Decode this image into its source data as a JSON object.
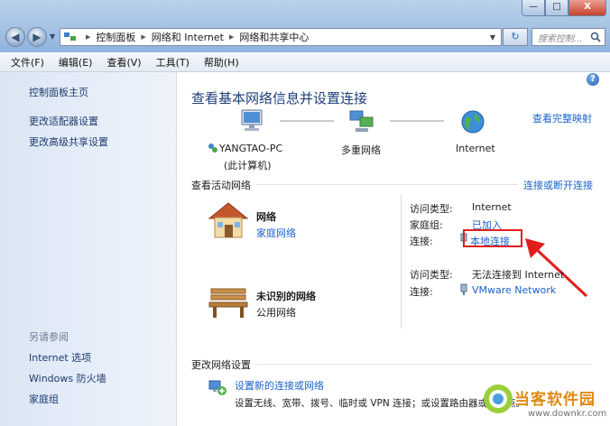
{
  "window": {
    "min": "—",
    "max": "□",
    "close": "X"
  },
  "address": {
    "crumbs": [
      "控制面板",
      "网络和 Internet",
      "网络和共享中心"
    ]
  },
  "search": {
    "placeholder": "搜索控制..."
  },
  "menu": [
    "文件(F)",
    "编辑(E)",
    "查看(V)",
    "工具(T)",
    "帮助(H)"
  ],
  "sidebar": {
    "home": "控制面板主页",
    "adapter": "更改适配器设置",
    "advanced": "更改高级共享设置",
    "see_also": "另请参阅",
    "links": [
      "Internet 选项",
      "Windows 防火墙",
      "家庭组"
    ]
  },
  "main": {
    "title": "查看基本网络信息并设置连接",
    "full_map": "查看完整映射",
    "map": {
      "pc_name": "YANGTAO-PC",
      "pc_sub": "(此计算机)",
      "middle": "多重网络",
      "internet": "Internet"
    },
    "active_header": "查看活动网络",
    "connect_disconnect": "连接或断开连接",
    "network1": {
      "name": "网络",
      "type": "家庭网络",
      "access_label": "访问类型:",
      "access_value": "Internet",
      "homegroup_label": "家庭组:",
      "homegroup_value": "已加入",
      "conn_label": "连接:",
      "conn_value": "本地连接"
    },
    "network2": {
      "name": "未识别的网络",
      "type": "公用网络",
      "access_label": "访问类型:",
      "access_value": "无法连接到 Internet",
      "conn_label": "连接:",
      "conn_value": "VMware Network"
    },
    "change_header": "更改网络设置",
    "setup_link": "设置新的连接或网络",
    "setup_desc": "设置无线、宽带、拨号、临时或 VPN 连接；或设置路由器或访问点。"
  },
  "watermark": {
    "name": "当客软件园",
    "url": "www.downkr.com"
  },
  "colors": {
    "link": "#1b62c9",
    "title": "#1e3f7a",
    "highlight": "#e01e1e"
  }
}
